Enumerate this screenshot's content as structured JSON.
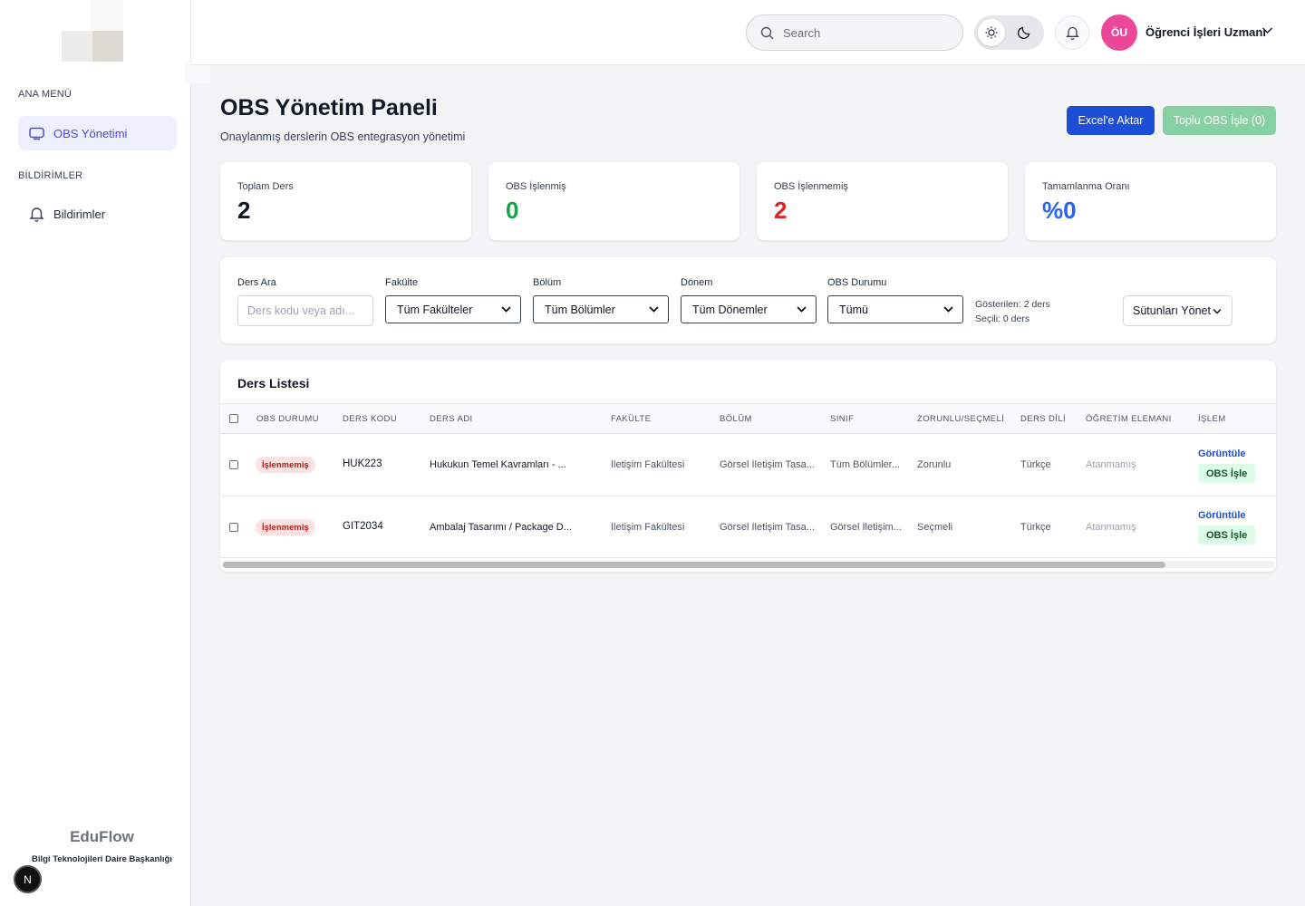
{
  "sidebar": {
    "sections": [
      "ANA MENÜ",
      "BİLDİRİMLER"
    ],
    "items": [
      {
        "label": "OBS Yönetimi",
        "icon": "monitor-icon",
        "active": true
      },
      {
        "label": "Bildirimler",
        "icon": "bell-icon",
        "active": false
      }
    ],
    "brand": "EduFlow",
    "brand_sub": "Bilgi Teknolojileri Daire Başkanlığı",
    "framework_badge": "N"
  },
  "topbar": {
    "search_placeholder": "Search",
    "theme_options": [
      "sun-icon",
      "moon-icon"
    ],
    "user_initials": "ÖU",
    "user_name": "Öğrenci İşleri Uzmanı"
  },
  "page": {
    "title": "OBS Yönetim Paneli",
    "subtitle": "Onaylanmış derslerin OBS entegrasyon yönetimi",
    "export_label": "Excel'e Aktar",
    "bulk_label": "Toplu OBS İşle (0)"
  },
  "stats": [
    {
      "label": "Toplam Ders",
      "value": "2",
      "color": "#111827"
    },
    {
      "label": "OBS İşlenmiş",
      "value": "0",
      "color": "#16a34a"
    },
    {
      "label": "OBS İşlenmemiş",
      "value": "2",
      "color": "#dc2626"
    },
    {
      "label": "Tamamlanma Oranı",
      "value": "%0",
      "color": "#2563eb"
    }
  ],
  "filters": {
    "search_label": "Ders Ara",
    "search_placeholder": "Ders kodu veya adı...",
    "faculty_label": "Fakülte",
    "faculty_value": "Tüm Fakülteler",
    "department_label": "Bölüm",
    "department_value": "Tüm Bölümler",
    "term_label": "Dönem",
    "term_value": "Tüm Dönemler",
    "obs_label": "OBS Durumu",
    "obs_value": "Tümü",
    "shown": "Gösterilen: 2 ders",
    "selected": "Seçili: 0 ders",
    "columns_button": "Sütunları Yönet"
  },
  "table": {
    "title": "Ders Listesi",
    "headers": [
      "OBS DURUMU",
      "DERS KODU",
      "DERS ADI",
      "FAKÜLTE",
      "BÖLÜM",
      "SINIF",
      "ZORUNLU/SEÇMELİ",
      "DERS DİLİ",
      "ÖĞRETİM ELEMANI",
      "İŞLEM"
    ],
    "rows": [
      {
        "status": "İşlenmemiş",
        "code": "HUK223",
        "name": "Hukukun Temel Kavramları - ...",
        "faculty": "İletişim Fakültesi",
        "department": "Görsel İletişim Tasa...",
        "class": "Tüm Bölümler...",
        "type": "Zorunlu",
        "language": "Türkçe",
        "instructor": "Atanmamış",
        "view": "Görüntüle",
        "process": "OBS İşle"
      },
      {
        "status": "İşlenmemiş",
        "code": "GIT2034",
        "name": "Ambalaj Tasarımı / Package D...",
        "faculty": "İletişim Fakültesi",
        "department": "Görsel İletişim Tasa...",
        "class": "Görsel İletişim...",
        "type": "Seçmeli",
        "language": "Türkçe",
        "instructor": "Atanmamış",
        "view": "Görüntüle",
        "process": "OBS İşle"
      }
    ]
  }
}
